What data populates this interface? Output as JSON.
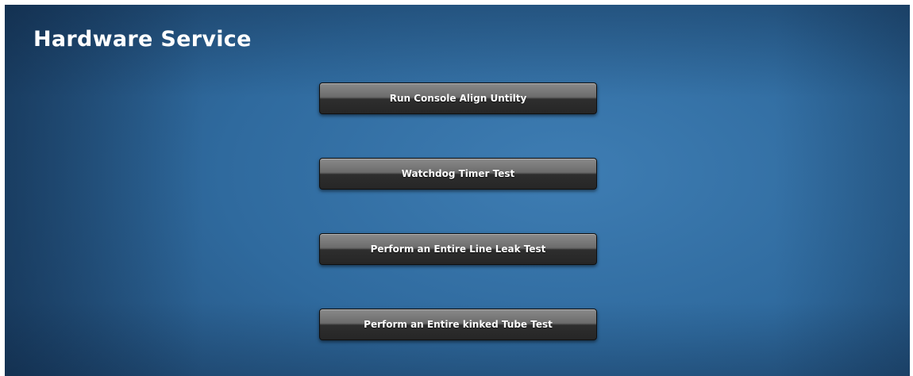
{
  "header": {
    "title": "Hardware Service"
  },
  "actions": [
    {
      "label": "Run Console Align Untilty"
    },
    {
      "label": "Watchdog Timer Test"
    },
    {
      "label": "Perform an Entire Line Leak Test"
    },
    {
      "label": "Perform an Entire kinked Tube Test"
    }
  ],
  "colors": {
    "background_center": "#3e7db3",
    "background_edge": "#1a3d60",
    "button_top": "#8a8a8a",
    "button_bottom": "#262626",
    "text": "#ffffff"
  }
}
